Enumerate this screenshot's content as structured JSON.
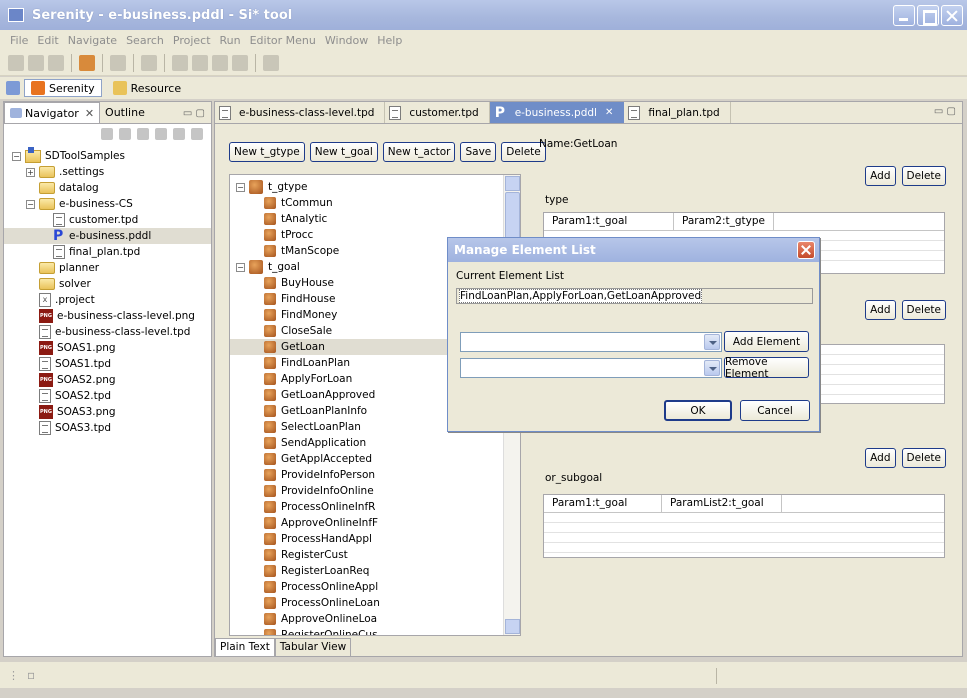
{
  "window": {
    "title": "Serenity - e-business.pddl - Si* tool"
  },
  "menu": [
    "File",
    "Edit",
    "Navigate",
    "Search",
    "Project",
    "Run",
    "Editor Menu",
    "Window",
    "Help"
  ],
  "perspectives": {
    "serenity": "Serenity",
    "resource": "Resource"
  },
  "left_panel": {
    "tabs": {
      "navigator": "Navigator",
      "outline": "Outline"
    },
    "tree": [
      {
        "label": "SDToolSamples",
        "icon": "project-icon",
        "depth": 0,
        "expand": "minus"
      },
      {
        "label": ".settings",
        "icon": "folder-icon",
        "depth": 1,
        "expand": "plus"
      },
      {
        "label": "datalog",
        "icon": "folder-icon",
        "depth": 1,
        "expand": ""
      },
      {
        "label": "e-business-CS",
        "icon": "folder-icon",
        "depth": 1,
        "expand": "minus"
      },
      {
        "label": "customer.tpd",
        "icon": "file-icon",
        "depth": 2,
        "expand": ""
      },
      {
        "label": "e-business.pddl",
        "icon": "pddl-icon",
        "depth": 2,
        "expand": "",
        "selected": true
      },
      {
        "label": "final_plan.tpd",
        "icon": "file-icon",
        "depth": 2,
        "expand": ""
      },
      {
        "label": "planner",
        "icon": "folder-icon",
        "depth": 1,
        "expand": ""
      },
      {
        "label": "solver",
        "icon": "folder-icon",
        "depth": 1,
        "expand": ""
      },
      {
        "label": ".project",
        "icon": "x-file-icon",
        "depth": 1,
        "expand": ""
      },
      {
        "label": "e-business-class-level.png",
        "icon": "png-icon",
        "depth": 1,
        "expand": ""
      },
      {
        "label": "e-business-class-level.tpd",
        "icon": "file-icon",
        "depth": 1,
        "expand": ""
      },
      {
        "label": "SOAS1.png",
        "icon": "png-icon",
        "depth": 1,
        "expand": ""
      },
      {
        "label": "SOAS1.tpd",
        "icon": "file-icon",
        "depth": 1,
        "expand": ""
      },
      {
        "label": "SOAS2.png",
        "icon": "png-icon",
        "depth": 1,
        "expand": ""
      },
      {
        "label": "SOAS2.tpd",
        "icon": "file-icon",
        "depth": 1,
        "expand": ""
      },
      {
        "label": "SOAS3.png",
        "icon": "png-icon",
        "depth": 1,
        "expand": ""
      },
      {
        "label": "SOAS3.tpd",
        "icon": "file-icon",
        "depth": 1,
        "expand": ""
      }
    ]
  },
  "editor": {
    "tabs": [
      {
        "label": "e-business-class-level.tpd",
        "active": false
      },
      {
        "label": "customer.tpd",
        "active": false
      },
      {
        "label": "e-business.pddl",
        "active": true
      },
      {
        "label": "final_plan.tpd",
        "active": false
      }
    ],
    "buttons": {
      "new_gtype": "New t_gtype",
      "new_goal": "New t_goal",
      "new_actor": "New t_actor",
      "save": "Save",
      "delete": "Delete"
    },
    "tree": {
      "gtype_label": "t_gtype",
      "gtype_items": [
        "tCommun",
        "tAnalytic",
        "tProcc",
        "tManScope"
      ],
      "goal_label": "t_goal",
      "goal_items": [
        "BuyHouse",
        "FindHouse",
        "FindMoney",
        "CloseSale",
        "GetLoan",
        "FindLoanPlan",
        "ApplyForLoan",
        "GetLoanApproved",
        "GetLoanPlanInfo",
        "SelectLoanPlan",
        "SendApplication",
        "GetApplAccepted",
        "ProvideInfoPerson",
        "ProvideInfoOnline",
        "ProcessOnlineInfR",
        "ApproveOnlineInfF",
        "ProcessHandAppl",
        "RegisterCust",
        "RegisterLoanReq",
        "ProcessOnlineAppl",
        "ProcessOnlineLoan",
        "ApproveOnlineLoa",
        "RegisterOnlineCus"
      ],
      "selected_goal": "GetLoan"
    },
    "bottom_tabs": {
      "plain": "Plain Text",
      "tabular": "Tabular View"
    },
    "name_label": "Name:GetLoan",
    "type_label": "type",
    "type_grid_headers": [
      "Param1:t_goal",
      "Param2:t_gtype"
    ],
    "or_label": "or_subgoal",
    "or_grid_headers": [
      "Param1:t_goal",
      "ParamList2:t_goal"
    ],
    "add_label": "Add",
    "delete_label": "Delete"
  },
  "dialog": {
    "title": "Manage Element List",
    "current_label": "Current Element List",
    "current_value": "FindLoanPlan,ApplyForLoan,GetLoanApproved",
    "add_element": "Add Element",
    "remove_element": "Remove Element",
    "ok": "OK",
    "cancel": "Cancel"
  }
}
